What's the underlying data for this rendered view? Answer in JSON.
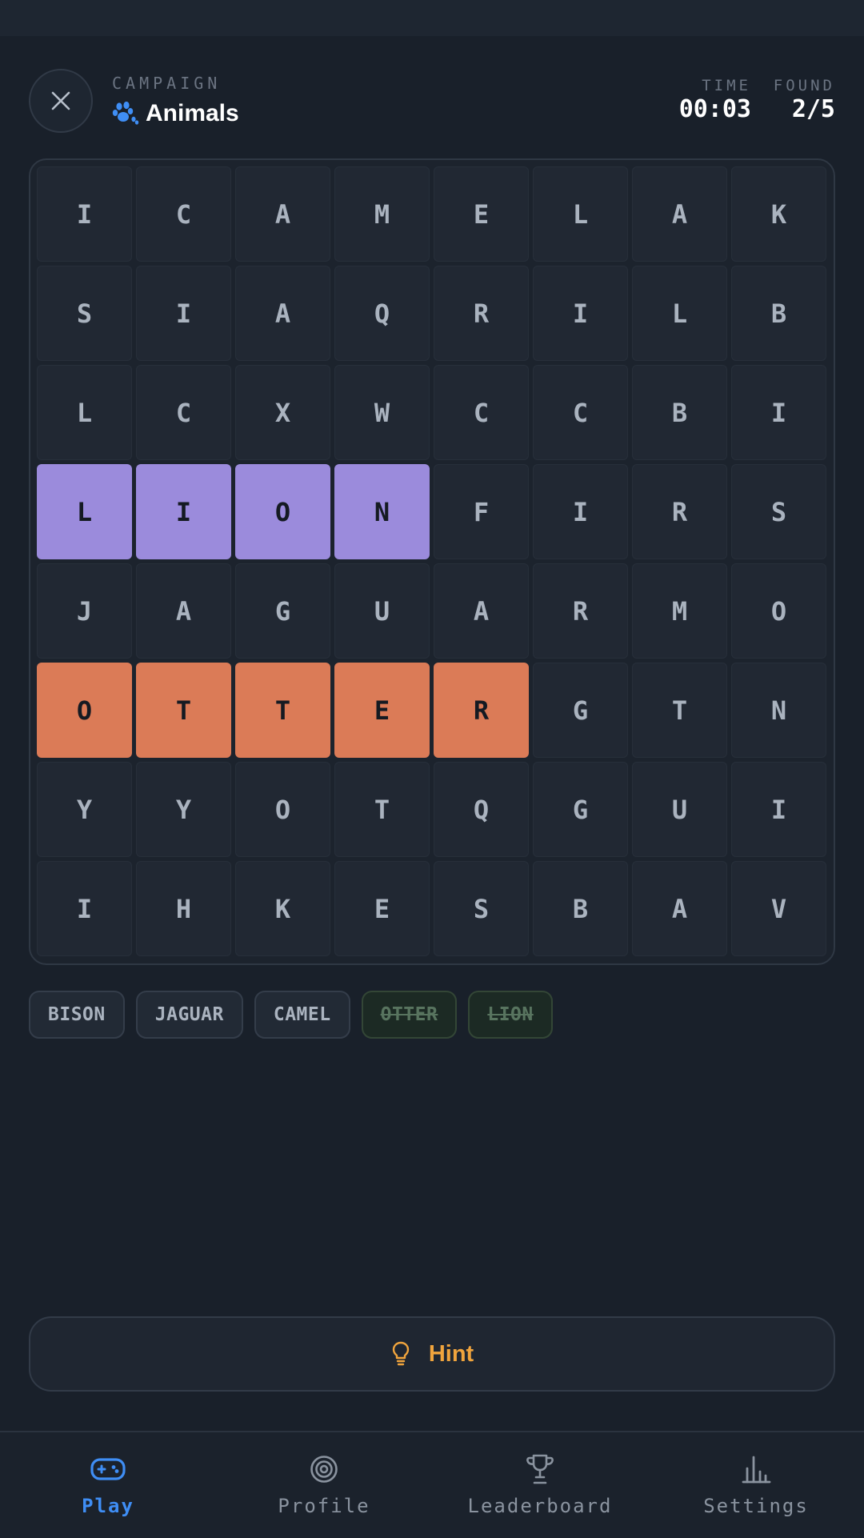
{
  "header": {
    "campaign_label": "CAMPAIGN",
    "campaign_title": "Animals",
    "campaign_icon": "paw-icon",
    "time_label": "TIME",
    "time_value": "00:03",
    "found_label": "FOUND",
    "found_value": "2/5"
  },
  "board": {
    "rows": [
      [
        "I",
        "C",
        "A",
        "M",
        "E",
        "L",
        "A",
        "K"
      ],
      [
        "S",
        "I",
        "A",
        "Q",
        "R",
        "I",
        "L",
        "B"
      ],
      [
        "L",
        "C",
        "X",
        "W",
        "C",
        "C",
        "B",
        "I"
      ],
      [
        "L",
        "I",
        "O",
        "N",
        "F",
        "I",
        "R",
        "S"
      ],
      [
        "J",
        "A",
        "G",
        "U",
        "A",
        "R",
        "M",
        "O"
      ],
      [
        "O",
        "T",
        "T",
        "E",
        "R",
        "G",
        "T",
        "N"
      ],
      [
        "Y",
        "Y",
        "O",
        "T",
        "Q",
        "G",
        "U",
        "I"
      ],
      [
        "I",
        "H",
        "K",
        "E",
        "S",
        "B",
        "A",
        "V"
      ]
    ],
    "highlights": [
      {
        "word": "LION",
        "row": 3,
        "cols": [
          0,
          3
        ],
        "color": "#9b8bdc"
      },
      {
        "word": "OTTER",
        "row": 5,
        "cols": [
          0,
          4
        ],
        "color": "#db7b57"
      }
    ]
  },
  "words": [
    {
      "label": "BISON",
      "found": false
    },
    {
      "label": "JAGUAR",
      "found": false
    },
    {
      "label": "CAMEL",
      "found": false
    },
    {
      "label": "OTTER",
      "found": true
    },
    {
      "label": "LION",
      "found": true
    }
  ],
  "hint": {
    "label": "Hint",
    "icon": "lightbulb-icon",
    "color": "#f0a43d"
  },
  "nav": {
    "active_color": "#3f8ef5",
    "items": [
      {
        "label": "Play",
        "icon": "gamepad-icon",
        "active": true
      },
      {
        "label": "Profile",
        "icon": "target-icon",
        "active": false
      },
      {
        "label": "Leaderboard",
        "icon": "trophy-icon",
        "active": false
      },
      {
        "label": "Settings",
        "icon": "bar-chart-icon",
        "active": false
      }
    ]
  }
}
